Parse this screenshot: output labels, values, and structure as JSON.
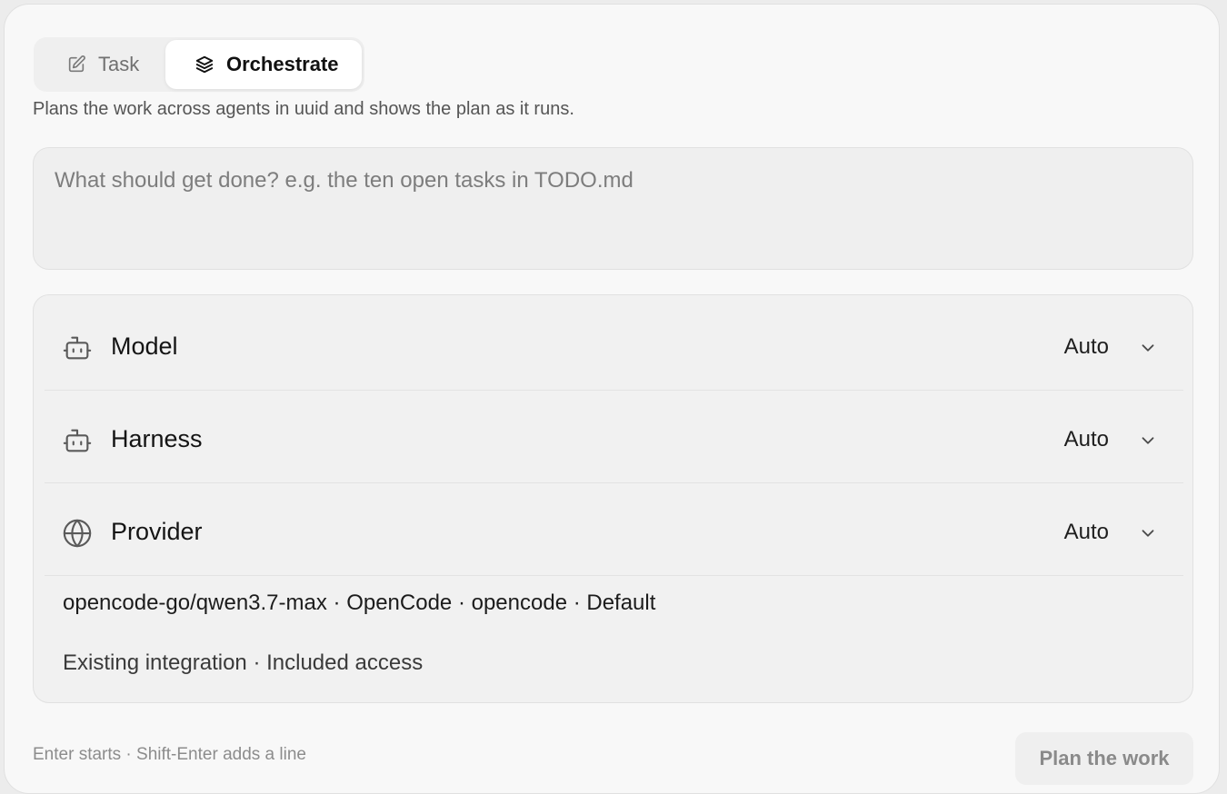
{
  "tabs": {
    "task": {
      "label": "Task",
      "icon": "edit-icon"
    },
    "orchestrate": {
      "label": "Orchestrate",
      "icon": "layers-icon",
      "selected": true
    }
  },
  "subtitle": "Plans the work across agents in uuid and shows the plan as it runs.",
  "prompt": {
    "value": "",
    "placeholder": "What should get done? e.g. the ten open tasks in TODO.md"
  },
  "options": {
    "model": {
      "label": "Model",
      "value": "Auto",
      "icon": "bot-icon"
    },
    "harness": {
      "label": "Harness",
      "value": "Auto",
      "icon": "bot-icon"
    },
    "provider": {
      "label": "Provider",
      "value": "Auto",
      "icon": "globe-icon"
    },
    "details": "opencode-go/qwen3.7-max · OpenCode · opencode · Default",
    "access": "Existing integration · Included access"
  },
  "footer": {
    "hint": "Enter starts · Shift-Enter adds a line",
    "submit_label": "Plan the work"
  },
  "colors": {
    "background": "#f8f8f8",
    "surface": "#efefef",
    "selected_tab": "#ffffff",
    "text": "#141414",
    "muted": "#7d7d7d"
  }
}
